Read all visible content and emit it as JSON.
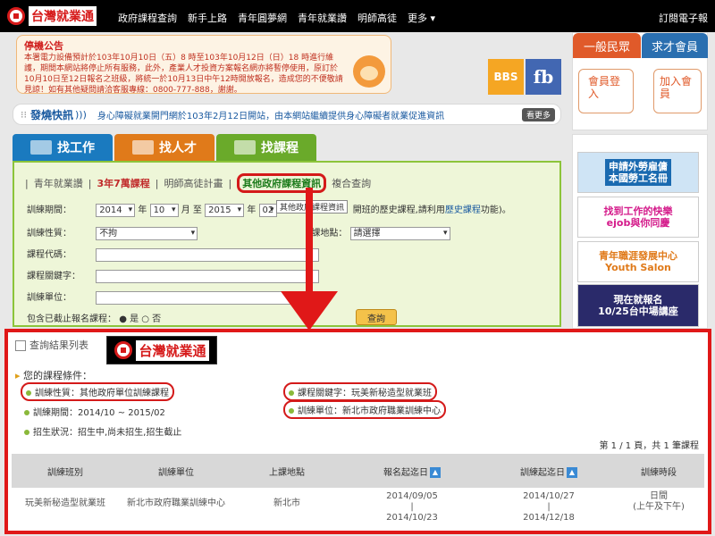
{
  "nav": {
    "logo": "台灣就業通",
    "items": [
      "政府課程查詢",
      "新手上路",
      "青年圓夢網",
      "青年就業讚",
      "明師高徒",
      "更多 ▾"
    ],
    "subscribe": "訂閱電子報"
  },
  "notice": {
    "title": "停機公告",
    "body": "本署電力設備預計於103年10月10日（五）8 時至103年10月12日（日）18 時進行維護，期間本網站將停止所有服務，此外，產業人才投資方案報名網亦將暫停使用，原訂於10月10日至12日報名之班級，將統一於10月13日中午12時開放報名，造成您的不便敬請見諒！如有其他疑問請洽客服專線：0800-777-888，謝謝。"
  },
  "social": {
    "bbs": "BBS",
    "fb": "fb"
  },
  "member": {
    "tab_general": "一般民眾",
    "tab_seeker": "求才會員",
    "login": "會員登入",
    "join": "加入會員"
  },
  "news": {
    "label": "發燒快訊",
    "text": "身心障礙就業開門網於103年2月12日開站，由本網站繼續提供身心障礙者就業促進資訊",
    "more": "看更多"
  },
  "tabs": {
    "job": "找工作",
    "talent": "找人才",
    "course": "找課程"
  },
  "subnav": {
    "youth": "青年就業讚",
    "short": "3年7萬課程",
    "master": "明師高徒計畫",
    "other": "其他政府課程資訊",
    "composite": "複合查詢"
  },
  "form": {
    "period_label": "訓練期間：",
    "year_from": "2014",
    "year_unit1": "年",
    "month_from": "10",
    "month_unit1": "月 至",
    "year_to": "2015",
    "year_unit2": "年",
    "month_to": "02",
    "tooltip": "其他政府課程資訊",
    "note": "開班的歷史課程,請利用",
    "note_link": "歷史課程",
    "note_end": "功能)。",
    "nature_label": "訓練性質：",
    "nature_value": "不拘",
    "location_label": "課地點：",
    "location_value": "請選擇",
    "code_label": "課程代碼：",
    "keyword_label": "課程關鍵字：",
    "unit_label": "訓練單位：",
    "include_label": "包含已截止報名課程：",
    "radio_yes": "● 是",
    "radio_no": "○ 否",
    "search": "查詢"
  },
  "results": {
    "title": "查詢結果列表",
    "logo": "台灣就業通",
    "conditions_title": "您的課程條件：",
    "cond_nature": "訓練性質：其他政府單位訓練課程",
    "cond_keyword": "課程關鍵字：玩美新秘造型就業班",
    "cond_period": "訓練期間：2014/10 ~ 2015/02",
    "cond_unit": "訓練單位：新北市政府職業訓練中心",
    "cond_status": "招生狀況：招生中,尚未招生,招生截止",
    "page_info": "第 1 / 1 頁，共 1 筆課程",
    "headers": [
      "訓練班別",
      "訓練單位",
      "上課地點",
      "報名起迄日",
      "訓練起迄日",
      "訓練時段"
    ],
    "row": {
      "class": "玩美新秘造型就業班",
      "unit": "新北市政府職業訓練中心",
      "location": "新北市",
      "reg_start": "2014/09/05",
      "reg_end": "2014/10/23",
      "train_start": "2014/10/27",
      "train_end": "2014/12/18",
      "time": "日間",
      "time_detail": "(上午及下午)"
    }
  },
  "banners": {
    "b1": "申請外勞雇傭\n本國勞工名冊",
    "b2": "找到工作的快樂\nejob與你同慶",
    "b3": "青年職涯發展中心\nYouth Salon",
    "b4": "現在就報名\n10/25台中場講座"
  },
  "colors": {
    "accent_red": "#e01818",
    "green": "#8cc43a",
    "blue": "#1a7abf"
  }
}
